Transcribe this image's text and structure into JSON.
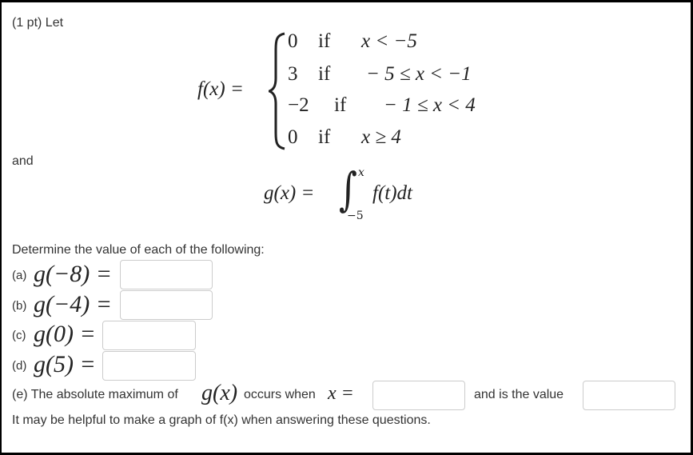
{
  "problem": {
    "intro": "(1 pt) Let",
    "f_lhs": "f(x) =",
    "cases": [
      {
        "value": "0",
        "cond_word": "if",
        "condition": "x < −5"
      },
      {
        "value": "3",
        "cond_word": "if",
        "condition": "− 5 ≤ x < −1"
      },
      {
        "value": "−2",
        "cond_word": "if",
        "condition": "− 1 ≤ x < 4"
      },
      {
        "value": "0",
        "cond_word": "if",
        "condition": "x ≥ 4"
      }
    ],
    "and_label": "and",
    "g_lhs": "g(x) =",
    "integral_upper": "x",
    "integral_lower": "−5",
    "integrand": "f(t)dt",
    "determine": "Determine the value of each of the following:"
  },
  "questions": [
    {
      "label": "(a)",
      "expr": "g(−8) =",
      "value": ""
    },
    {
      "label": "(b)",
      "expr": "g(−4) =",
      "value": ""
    },
    {
      "label": "(c)",
      "expr": "g(0) =",
      "value": ""
    },
    {
      "label": "(d)",
      "expr": "g(5) =",
      "value": ""
    }
  ],
  "part_e": {
    "prefix": "(e) The absolute maximum of",
    "g_expr": "g(x)",
    "middle": "occurs when",
    "x_expr": "x =",
    "x_value": "",
    "and_value": "and is the value",
    "max_value": ""
  },
  "hint": "It may be helpful to make a graph of f(x) when answering these questions."
}
